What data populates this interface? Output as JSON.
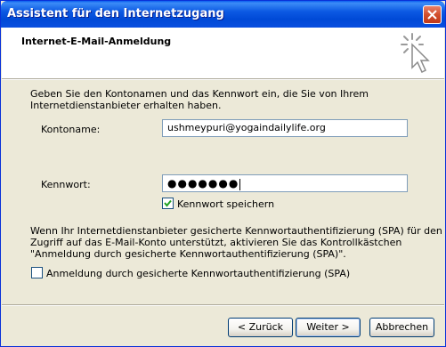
{
  "window": {
    "title": "Assistent für den Internetzugang",
    "header_title": "Internet-E-Mail-Anmeldung"
  },
  "intro": {
    "line1": "Geben Sie den Kontonamen und das Kennwort ein, die Sie von Ihrem",
    "line2": "Internetdienstanbieter erhalten haben."
  },
  "account": {
    "label": "Kontoname:",
    "value": "ushmeypuri@yogaindailylife.org"
  },
  "password": {
    "label": "Kennwort:",
    "value": "●●●●●●●",
    "remember_label": "Kennwort speichern",
    "remember_checked": true
  },
  "spa": {
    "line1": "Wenn Ihr Internetdienstanbieter gesicherte Kennwortauthentifizierung (SPA) für den",
    "line2": "Zugriff auf das E-Mail-Konto unterstützt, aktivieren Sie das Kontrollkästchen",
    "line3": "\"Anmeldung durch gesicherte Kennwortauthentifizierung (SPA)\".",
    "checkbox_label": "Anmeldung durch gesicherte Kennwortauthentifizierung (SPA)",
    "checked": false
  },
  "buttons": {
    "back": "< Zurück",
    "next": "Weiter >",
    "cancel": "Abbrechen"
  },
  "colors": {
    "titlebar": "#0A5EEF",
    "dialog_bg": "#ECE9D8",
    "close_button": "#D24F2C"
  }
}
